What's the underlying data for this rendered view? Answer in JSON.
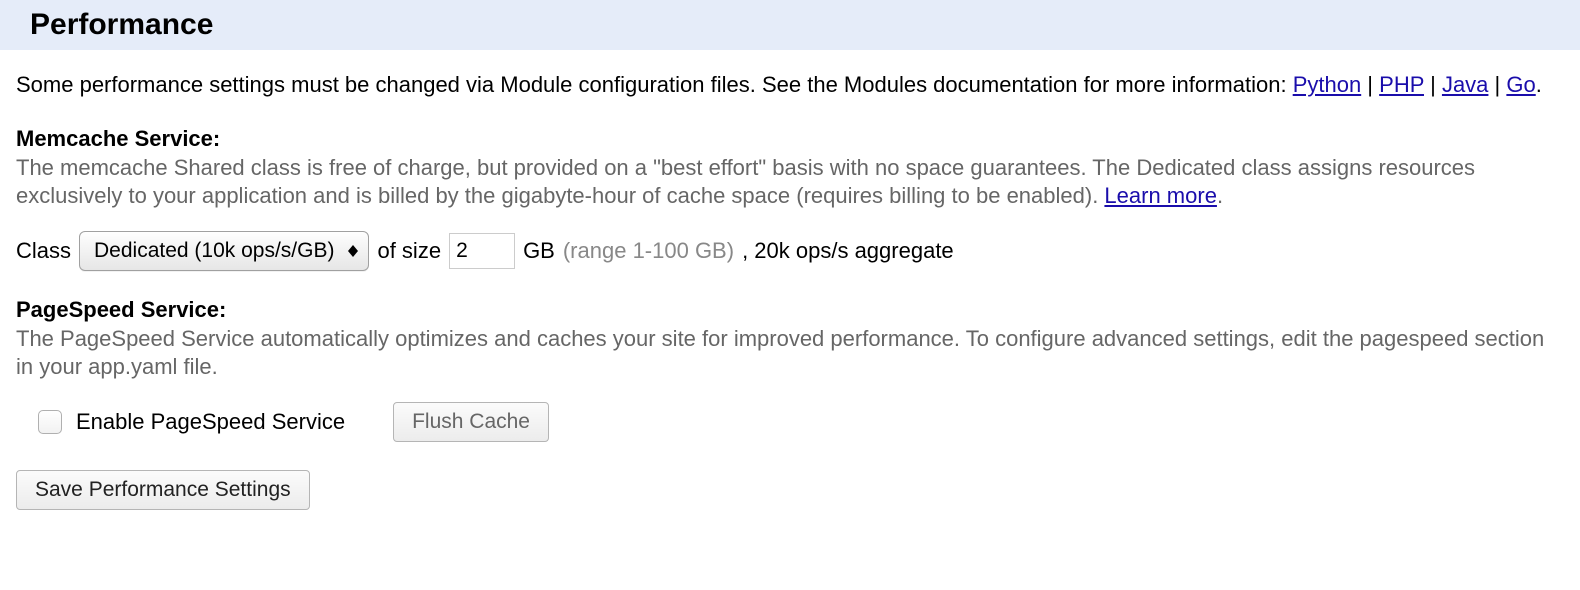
{
  "header": {
    "title": "Performance"
  },
  "intro": {
    "text_prefix": "Some performance settings must be changed via Module configuration files. See the Modules documentation for more information: ",
    "links": {
      "python": "Python",
      "php": "PHP",
      "java": "Java",
      "go": "Go"
    },
    "sep": " | ",
    "suffix": "."
  },
  "memcache": {
    "title": "Memcache Service:",
    "desc": "The memcache Shared class is free of charge, but provided on a \"best effort\" basis with no space guarantees. The Dedicated class assigns resources exclusively to your application and is billed by the gigabyte-hour of cache space (requires billing to be enabled). ",
    "learn_more": "Learn more",
    "desc_suffix": ".",
    "class_label": "Class",
    "class_selected": "Dedicated (10k ops/s/GB)",
    "of_size_label": "of size",
    "size_value": "2",
    "gb_label": "GB",
    "range_hint": "(range 1-100 GB)",
    "aggregate_prefix": ", ",
    "aggregate_text": "20k ops/s aggregate"
  },
  "pagespeed": {
    "title": "PageSpeed Service:",
    "desc": "The PageSpeed Service automatically optimizes and caches your site for improved performance. To configure advanced settings, edit the pagespeed section in your app.yaml file.",
    "enable_label": "Enable PageSpeed Service",
    "flush_label": "Flush Cache"
  },
  "save": {
    "label": "Save Performance Settings"
  }
}
